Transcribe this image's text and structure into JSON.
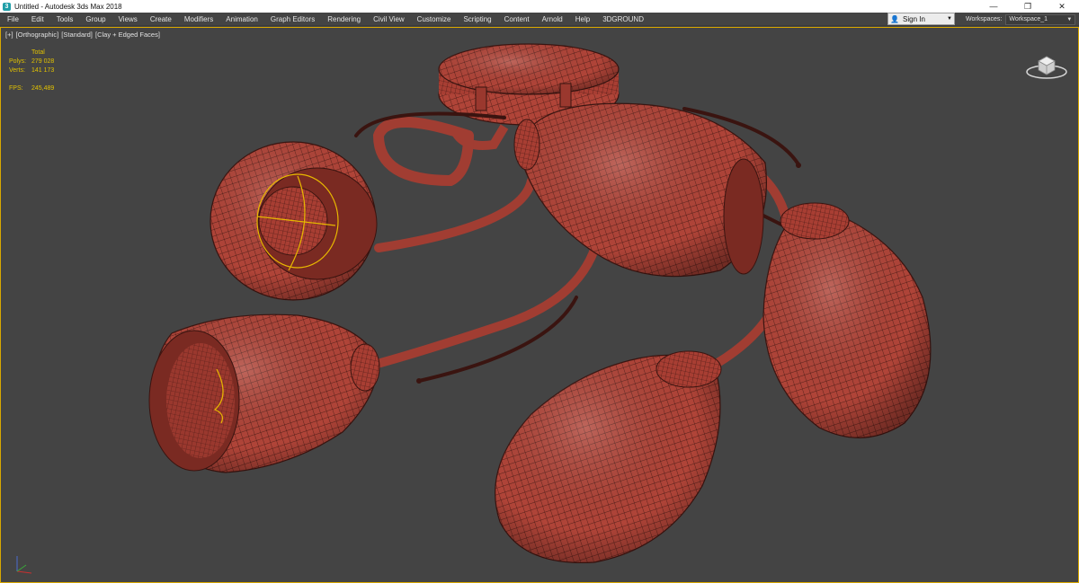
{
  "window": {
    "title": "Untitled - Autodesk 3ds Max 2018",
    "controls": [
      "minimize-icon",
      "restore-icon",
      "close-icon"
    ]
  },
  "menu": {
    "items": [
      "File",
      "Edit",
      "Tools",
      "Group",
      "Views",
      "Create",
      "Modifiers",
      "Animation",
      "Graph Editors",
      "Rendering",
      "Civil View",
      "Customize",
      "Scripting",
      "Content",
      "Arnold",
      "Help",
      "3DGROUND"
    ]
  },
  "account": {
    "sign_in_label": "Sign In"
  },
  "workspaces": {
    "label": "Workspaces:",
    "selected": "Workspace_1"
  },
  "viewport": {
    "labels": [
      "[+]",
      "[Orthographic]",
      "[Standard]",
      "[Clay + Edged Faces]"
    ],
    "stats": {
      "header": "Total",
      "polys_label": "Polys:",
      "polys_value": "279 028",
      "verts_label": "Verts:",
      "verts_value": "141 173",
      "fps_label": "FPS:",
      "fps_value": "245,489"
    }
  },
  "colors": {
    "viewport_bg": "#444444",
    "clay": "#b04438",
    "wire": "#3a1410",
    "selection": "#e8b800",
    "stat_text": "#e2c200"
  }
}
